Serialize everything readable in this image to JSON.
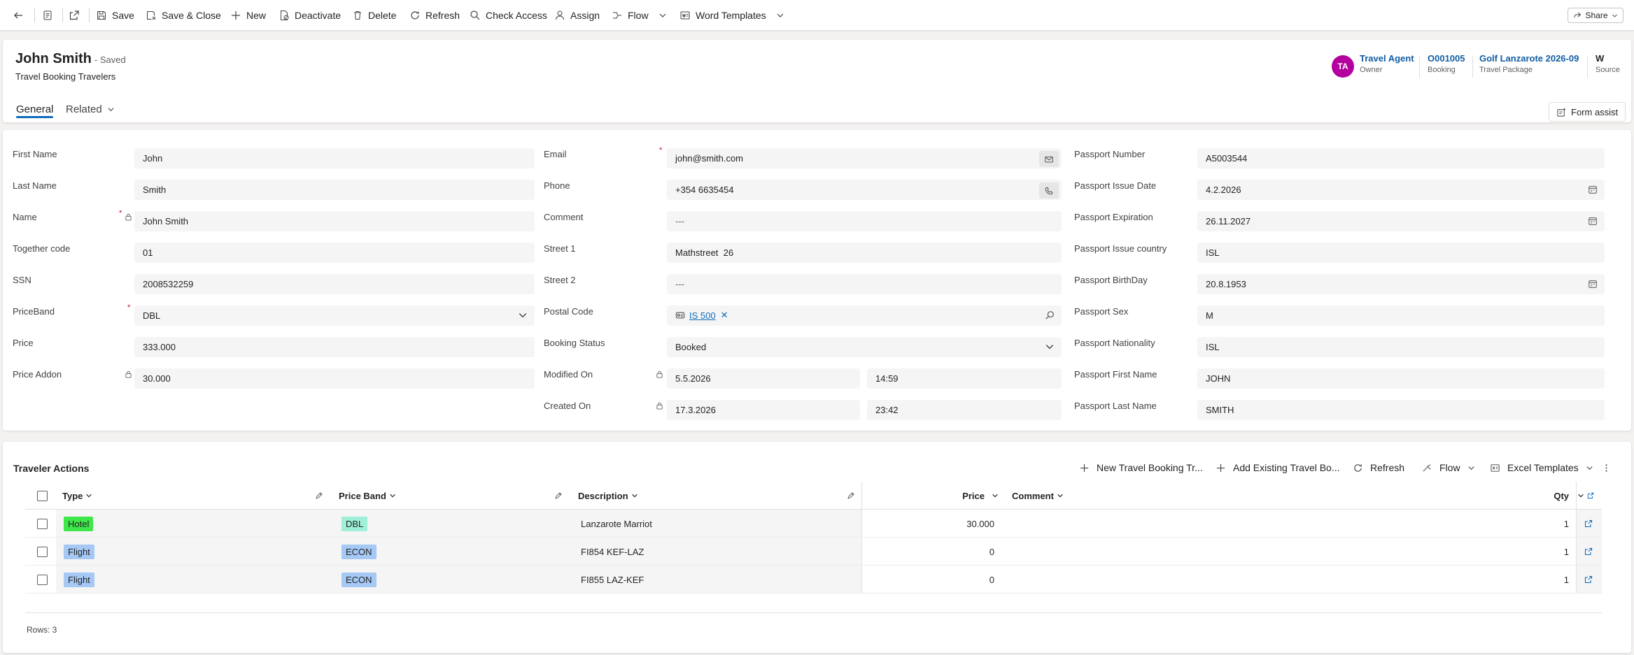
{
  "toolbar": {
    "save": "Save",
    "save_close": "Save & Close",
    "new": "New",
    "deactivate": "Deactivate",
    "delete": "Delete",
    "refresh": "Refresh",
    "check_access": "Check Access",
    "assign": "Assign",
    "flow": "Flow",
    "word_templates": "Word Templates",
    "share": "Share"
  },
  "header": {
    "title": "John Smith",
    "status": "- Saved",
    "entity": "Travel Booking Travelers",
    "tabs": {
      "general": "General",
      "related": "Related"
    },
    "avatar_initials": "TA",
    "owner": {
      "value": "Travel Agent",
      "label": "Owner"
    },
    "booking": {
      "value": "O001005",
      "label": "Booking"
    },
    "package": {
      "value": "Golf Lanzarote 2026-09",
      "label": "Travel Package"
    },
    "source": {
      "value": "W",
      "label": "Source"
    },
    "form_assist": "Form assist",
    "avatar_color": "#b4009e"
  },
  "form": {
    "col1": [
      {
        "label": "First Name",
        "value": "John"
      },
      {
        "label": "Last Name",
        "value": "Smith"
      },
      {
        "label": "Name",
        "value": "John Smith"
      },
      {
        "label": "Together code",
        "value": "01"
      },
      {
        "label": "SSN",
        "value": "2008532259"
      },
      {
        "label": "PriceBand",
        "value": "DBL"
      },
      {
        "label": "Price",
        "value": "333.000"
      },
      {
        "label": "Price Addon",
        "value": "30.000"
      }
    ],
    "col2": [
      {
        "label": "Email",
        "value": "john@smith.com"
      },
      {
        "label": "Phone",
        "value": "+354 6635454"
      },
      {
        "label": "Comment",
        "value": "---"
      },
      {
        "label": "Street 1",
        "value": "Mathstreet  26"
      },
      {
        "label": "Street 2",
        "value": "---"
      },
      {
        "label": "Postal Code",
        "value": "IS 500"
      },
      {
        "label": "Booking Status",
        "value": "Booked"
      },
      {
        "label": "Modified On",
        "date": "5.5.2026",
        "time": "14:59"
      },
      {
        "label": "Created On",
        "date": "17.3.2026",
        "time": "23:42"
      }
    ],
    "col3": [
      {
        "label": "Passport Number",
        "value": "A5003544"
      },
      {
        "label": "Passport Issue Date",
        "value": "4.2.2026"
      },
      {
        "label": "Passport Expiration",
        "value": "26.11.2027"
      },
      {
        "label": "Passport Issue country",
        "value": "ISL"
      },
      {
        "label": "Passport BirthDay",
        "value": "20.8.1953"
      },
      {
        "label": "Passport Sex",
        "value": "M"
      },
      {
        "label": "Passport Nationality",
        "value": "ISL"
      },
      {
        "label": "Passport First Name",
        "value": "JOHN"
      },
      {
        "label": "Passport Last Name",
        "value": "SMITH"
      }
    ]
  },
  "subgrid": {
    "title": "Traveler Actions",
    "commands": {
      "new": "New Travel Booking Tr...",
      "add_existing": "Add Existing Travel Bo...",
      "refresh": "Refresh",
      "flow": "Flow",
      "excel": "Excel Templates"
    },
    "columns": {
      "type": "Type",
      "price_band": "Price Band",
      "description": "Description",
      "price": "Price",
      "comment": "Comment",
      "qty": "Qty"
    },
    "rows": [
      {
        "type": "Hotel",
        "price_band": "DBL",
        "description": "Lanzarote Marriot",
        "price": "30.000",
        "comment": "",
        "qty": "1"
      },
      {
        "type": "Flight",
        "price_band": "ECON",
        "description": "FI854 KEF-LAZ",
        "price": "0",
        "comment": "",
        "qty": "1"
      },
      {
        "type": "Flight",
        "price_band": "ECON",
        "description": "FI855 LAZ-KEF",
        "price": "0",
        "comment": "",
        "qty": "1"
      }
    ],
    "rows_count": "Rows: 3",
    "colors": {
      "hotel": "#3fe84a",
      "flight": "#a5c8f5",
      "dbl": "#9ef0d8",
      "econ": "#a5c8f5"
    }
  }
}
